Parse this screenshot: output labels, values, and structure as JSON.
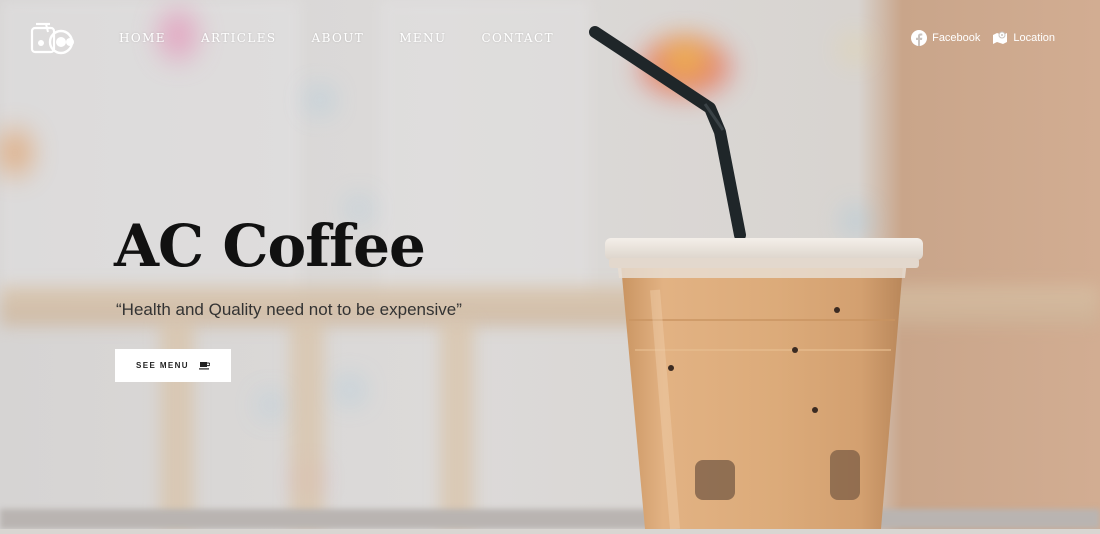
{
  "nav": {
    "links": [
      {
        "label": "HOME"
      },
      {
        "label": "ARTICLES"
      },
      {
        "label": "ABOUT"
      },
      {
        "label": "MENU"
      },
      {
        "label": "CONTACT"
      }
    ],
    "social": [
      {
        "label": "Facebook",
        "icon": "facebook-icon"
      },
      {
        "label": "Location",
        "icon": "map-icon"
      }
    ]
  },
  "hero": {
    "title": "AC Coffee",
    "tagline": "“Health and Quality need not to be expensive”",
    "cta_label": "SEE MENU",
    "cta_icon": "coffee-cup-icon"
  },
  "colors": {
    "text_dark": "#111111",
    "nav_text": "#ffffff",
    "button_bg": "#ffffff",
    "coffee": "#d7a574"
  }
}
